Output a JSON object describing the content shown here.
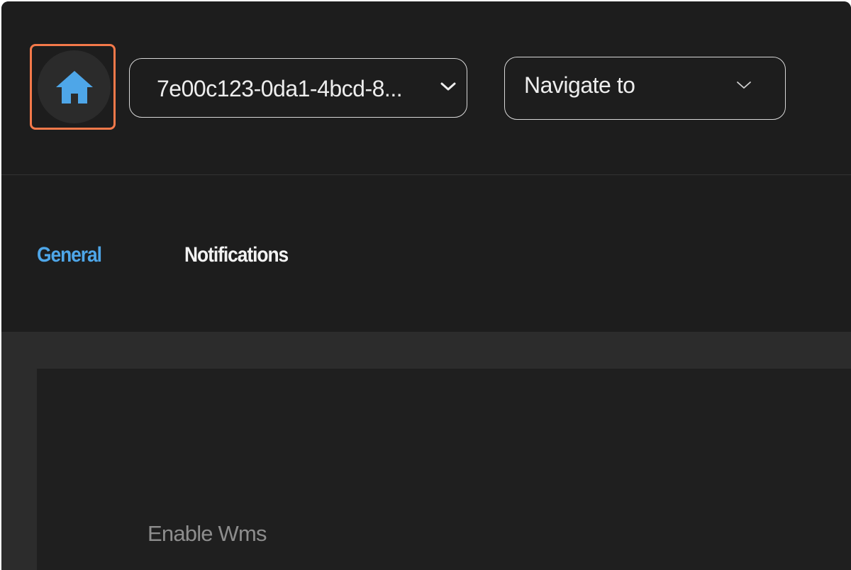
{
  "header": {
    "home_icon": "home-icon",
    "highlight_color": "#f4794a",
    "accent_color": "#4ea6e8",
    "id_select": {
      "value": "7e00c123-0da1-4bcd-8..."
    },
    "navigate_select": {
      "value": "Navigate to"
    }
  },
  "tabs": [
    {
      "label": "General",
      "active": true
    },
    {
      "label": "Notifications",
      "active": false
    }
  ],
  "content": {
    "fields": [
      {
        "label": "Enable Wms"
      }
    ]
  }
}
